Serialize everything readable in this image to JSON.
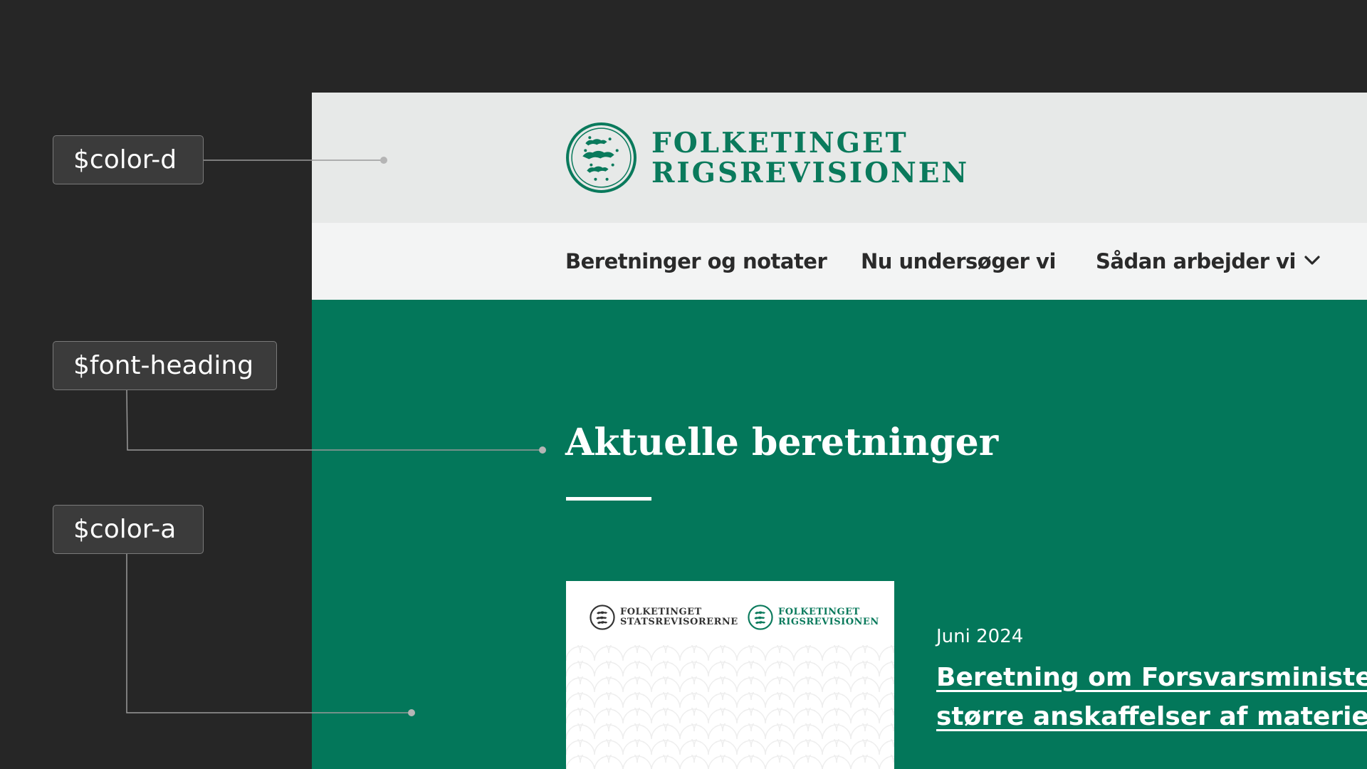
{
  "annotations": {
    "color_d": "$color-d",
    "font_heading": "$font-heading",
    "color_a": "$color-a"
  },
  "site": {
    "logo": {
      "line1": "FOLKETINGET",
      "line2": "RIGSREVISIONEN",
      "icon": "crest-icon"
    },
    "nav": {
      "item1": "Beretninger og notater",
      "item2": "Nu undersøger vi",
      "item3": "Sådan arbejder vi",
      "dropdown_icon": "chevron-down-icon"
    },
    "section": {
      "heading": "Aktuelle beretninger"
    },
    "report": {
      "card_logo1_line1": "FOLKETINGET",
      "card_logo1_line2": "STATSREVISORERNE",
      "card_logo2_line1": "FOLKETINGET",
      "card_logo2_line2": "RIGSREVISIONEN",
      "date": "Juni 2024",
      "title_line1": "Beretning om Forsvarsminister",
      "title_line2": "større anskaffelser af materiel"
    }
  },
  "colors": {
    "background": "#262626",
    "brand_green": "#03775a",
    "logo_green": "#0a7a5c",
    "header_gray": "#e7e9e8",
    "nav_gray": "#f3f4f4"
  }
}
